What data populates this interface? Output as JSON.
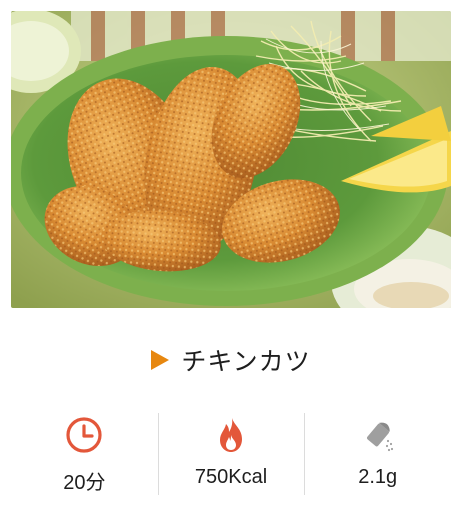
{
  "photo": {
    "alt": ""
  },
  "recipe": {
    "title": "チキンカツ"
  },
  "stats": {
    "time": {
      "icon": "clock-icon",
      "value": "20分"
    },
    "calories": {
      "icon": "flame-icon",
      "value": "750Kcal"
    },
    "salt": {
      "icon": "salt-shaker-icon",
      "value": "2.1g"
    }
  },
  "colors": {
    "accent": "#e7870f",
    "icon_red": "#e3573a",
    "icon_gray": "#a0a0a0",
    "divider": "#dcdcdc"
  }
}
